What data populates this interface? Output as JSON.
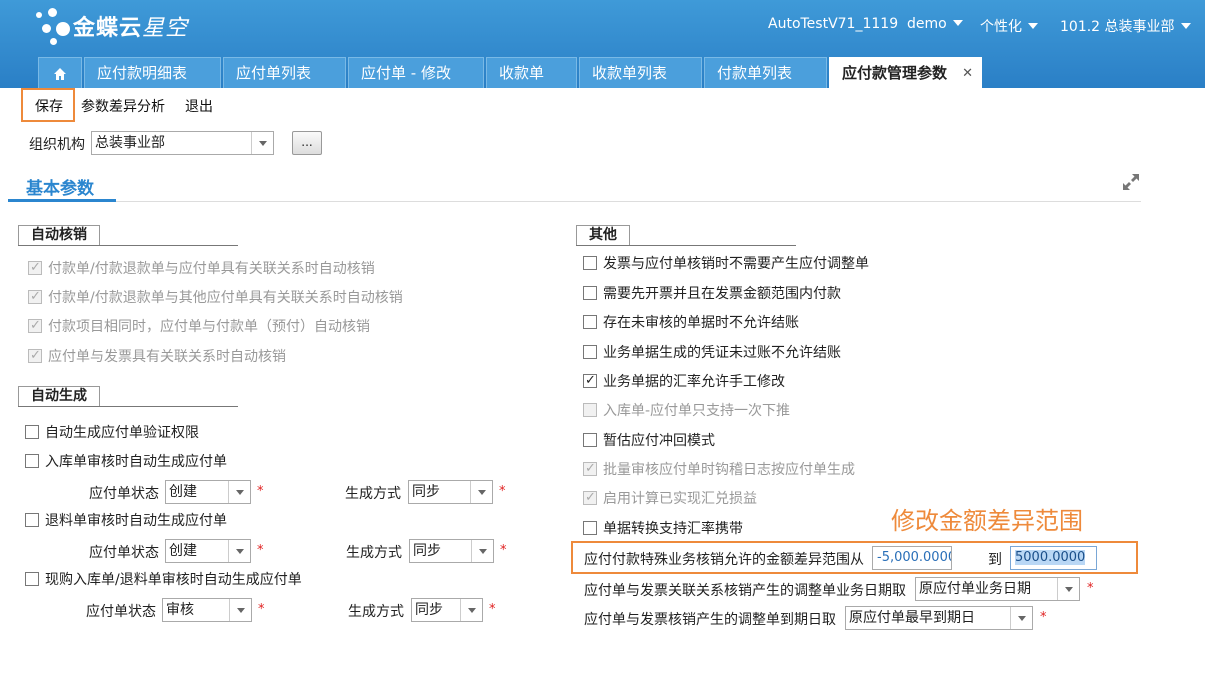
{
  "header": {
    "logo_main": "金蝶云",
    "logo_sub": "星空",
    "user_account": "AutoTestV71_1119",
    "datacenter": "demo",
    "personalize": "个性化",
    "org": "101.2 总装事业部"
  },
  "tabs": [
    {
      "label": "应付款明细表"
    },
    {
      "label": "应付单列表"
    },
    {
      "label": "应付单 - 修改"
    },
    {
      "label": "收款单"
    },
    {
      "label": "收款单列表"
    },
    {
      "label": "付款单列表"
    },
    {
      "label": "应付款管理参数",
      "active": true
    }
  ],
  "toolbar": {
    "save": "保存",
    "param_diff": "参数差异分析",
    "exit": "退出"
  },
  "org_filter": {
    "label": "组织机构",
    "value": "总装事业部",
    "ellipsis": "..."
  },
  "section_title": "基本参数",
  "auto_writeoff": {
    "title": "自动核销",
    "items": [
      {
        "label": "付款单/付款退款单与应付单具有关联关系时自动核销",
        "checked": true,
        "disabled": true
      },
      {
        "label": "付款单/付款退款单与其他应付单具有关联关系时自动核销",
        "checked": true,
        "disabled": true
      },
      {
        "label": "付款项目相同时，应付单与付款单（预付）自动核销",
        "checked": true,
        "disabled": true
      },
      {
        "label": "应付单与发票具有关联关系时自动核销",
        "checked": true,
        "disabled": true
      }
    ]
  },
  "auto_generate": {
    "title": "自动生成",
    "verify_perm": "自动生成应付单验证权限",
    "stock_in": "入库单审核时自动生成应付单",
    "return": "退料单审核时自动生成应付单",
    "cash_purchase": "现购入库单/退料单审核时自动生成应付单",
    "status_label": "应付单状态",
    "mode_label": "生成方式",
    "status_values": [
      "创建",
      "创建",
      "审核"
    ],
    "mode_values": [
      "同步",
      "同步",
      "同步"
    ],
    "required_mark": "*"
  },
  "other": {
    "title": "其他",
    "items": [
      {
        "label": "发票与应付单核销时不需要产生应付调整单",
        "checked": false,
        "disabled": false
      },
      {
        "label": "需要先开票并且在发票金额范围内付款",
        "checked": false,
        "disabled": false
      },
      {
        "label": "存在未审核的单据时不允许结账",
        "checked": false,
        "disabled": false
      },
      {
        "label": "业务单据生成的凭证未过账不允许结账",
        "checked": false,
        "disabled": false
      },
      {
        "label": "业务单据的汇率允许手工修改",
        "checked": true,
        "disabled": false
      },
      {
        "label": "入库单-应付单只支持一次下推",
        "checked": false,
        "disabled": true
      },
      {
        "label": "暂估应付冲回模式",
        "checked": false,
        "disabled": false
      },
      {
        "label": "批量审核应付单时钩稽日志按应付单生成",
        "checked": true,
        "disabled": true
      },
      {
        "label": "启用计算已实现汇兑损益",
        "checked": true,
        "disabled": true
      },
      {
        "label": "单据转换支持汇率携带",
        "checked": false,
        "disabled": false
      }
    ],
    "diff_range_label": "应付付款特殊业务核销允许的金额差异范围从",
    "diff_from": "-5,000.0000",
    "diff_to_label": "到",
    "diff_to": "5000.0000",
    "adj_date_label": "应付单与发票关联关系核销产生的调整单业务日期取",
    "adj_date_value": "原应付单业务日期",
    "due_date_label": "应付单与发票核销产生的调整单到期日取",
    "due_date_value": "原应付单最早到期日"
  },
  "annotation": "修改金额差异范围",
  "colors": {
    "header_blue": "#2a7fc6",
    "accent_blue": "#2b86cf",
    "highlight_orange": "#ee8a3b",
    "required_red": "#e02020"
  }
}
